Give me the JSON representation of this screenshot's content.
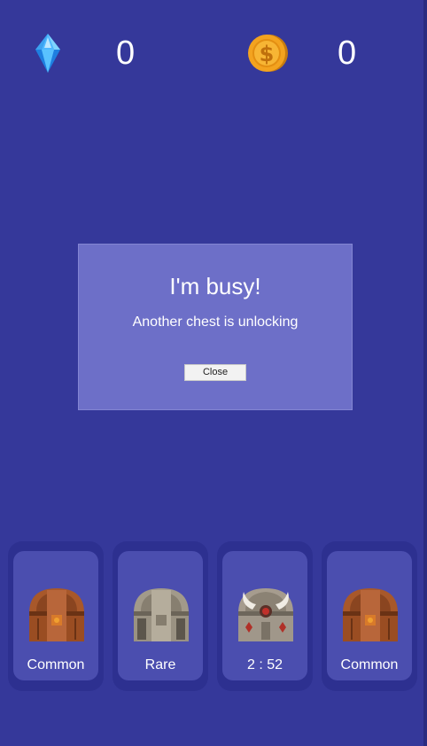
{
  "hud": {
    "gems": {
      "icon": "blue-gem-icon",
      "value": "0"
    },
    "coins": {
      "icon": "gold-coin-icon",
      "value": "0"
    }
  },
  "dialog": {
    "title": "I'm busy!",
    "message": "Another chest is unlocking",
    "close_label": "Close"
  },
  "chest_slots": [
    {
      "label": "Common",
      "chest": "common-wooden-chest-icon"
    },
    {
      "label": "Rare",
      "chest": "rare-stone-chest-icon"
    },
    {
      "label": "2 : 52",
      "chest": "epic-horned-chest-icon"
    },
    {
      "label": "Common",
      "chest": "common-wooden-chest-icon"
    }
  ],
  "colors": {
    "background": "#35389a",
    "dialog": "#6d6fc8",
    "slot_outer": "#2d3090",
    "slot_inner": "#4b4eaf"
  }
}
